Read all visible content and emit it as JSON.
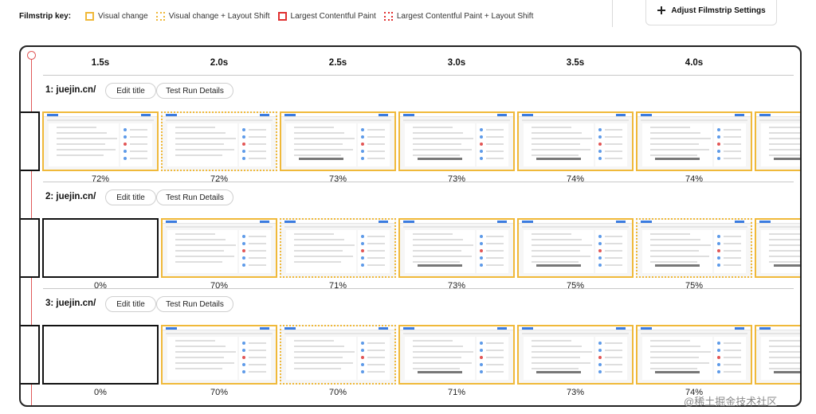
{
  "key": {
    "title": "Filmstrip key:",
    "items": [
      {
        "label": "Visual change",
        "style": "visual"
      },
      {
        "label": "Visual change + Layout Shift",
        "style": "visual-shift"
      },
      {
        "label": "Largest Contentful Paint",
        "style": "lcp"
      },
      {
        "label": "Largest Contentful Paint + Layout Shift",
        "style": "lcp-shift"
      }
    ]
  },
  "adjust_button": {
    "label": "Adjust Filmstrip Settings"
  },
  "times": [
    "1.5s",
    "2.0s",
    "2.5s",
    "3.0s",
    "3.5s",
    "4.0s"
  ],
  "colors": {
    "visual": "#f0b93a",
    "lcp": "#e03131",
    "timeline": "#e05a5a"
  },
  "runs": [
    {
      "title": "1: juejin.cn/",
      "edit_label": "Edit title",
      "details_label": "Test Run Details",
      "frames": [
        {
          "pct": "72%",
          "style": "visual",
          "content": "partial"
        },
        {
          "pct": "72%",
          "style": "visual-shift",
          "content": "partial"
        },
        {
          "pct": "73%",
          "style": "visual",
          "content": "full"
        },
        {
          "pct": "73%",
          "style": "visual",
          "content": "full"
        },
        {
          "pct": "74%",
          "style": "visual",
          "content": "full"
        },
        {
          "pct": "74%",
          "style": "visual",
          "content": "full"
        }
      ]
    },
    {
      "title": "2: juejin.cn/",
      "edit_label": "Edit title",
      "details_label": "Test Run Details",
      "frames": [
        {
          "pct": "0%",
          "style": "blank",
          "content": "none"
        },
        {
          "pct": "70%",
          "style": "visual",
          "content": "partial"
        },
        {
          "pct": "71%",
          "style": "visual-shift",
          "content": "partial"
        },
        {
          "pct": "73%",
          "style": "visual",
          "content": "full"
        },
        {
          "pct": "75%",
          "style": "visual",
          "content": "full"
        },
        {
          "pct": "75%",
          "style": "visual-shift",
          "content": "full"
        }
      ]
    },
    {
      "title": "3: juejin.cn/",
      "edit_label": "Edit title",
      "details_label": "Test Run Details",
      "frames": [
        {
          "pct": "0%",
          "style": "blank",
          "content": "none"
        },
        {
          "pct": "70%",
          "style": "visual",
          "content": "partial"
        },
        {
          "pct": "70%",
          "style": "visual-shift",
          "content": "partial"
        },
        {
          "pct": "71%",
          "style": "visual",
          "content": "full"
        },
        {
          "pct": "73%",
          "style": "visual",
          "content": "full"
        },
        {
          "pct": "74%",
          "style": "visual",
          "content": "full"
        }
      ]
    }
  ],
  "watermark": "@稀土掘金技术社区"
}
